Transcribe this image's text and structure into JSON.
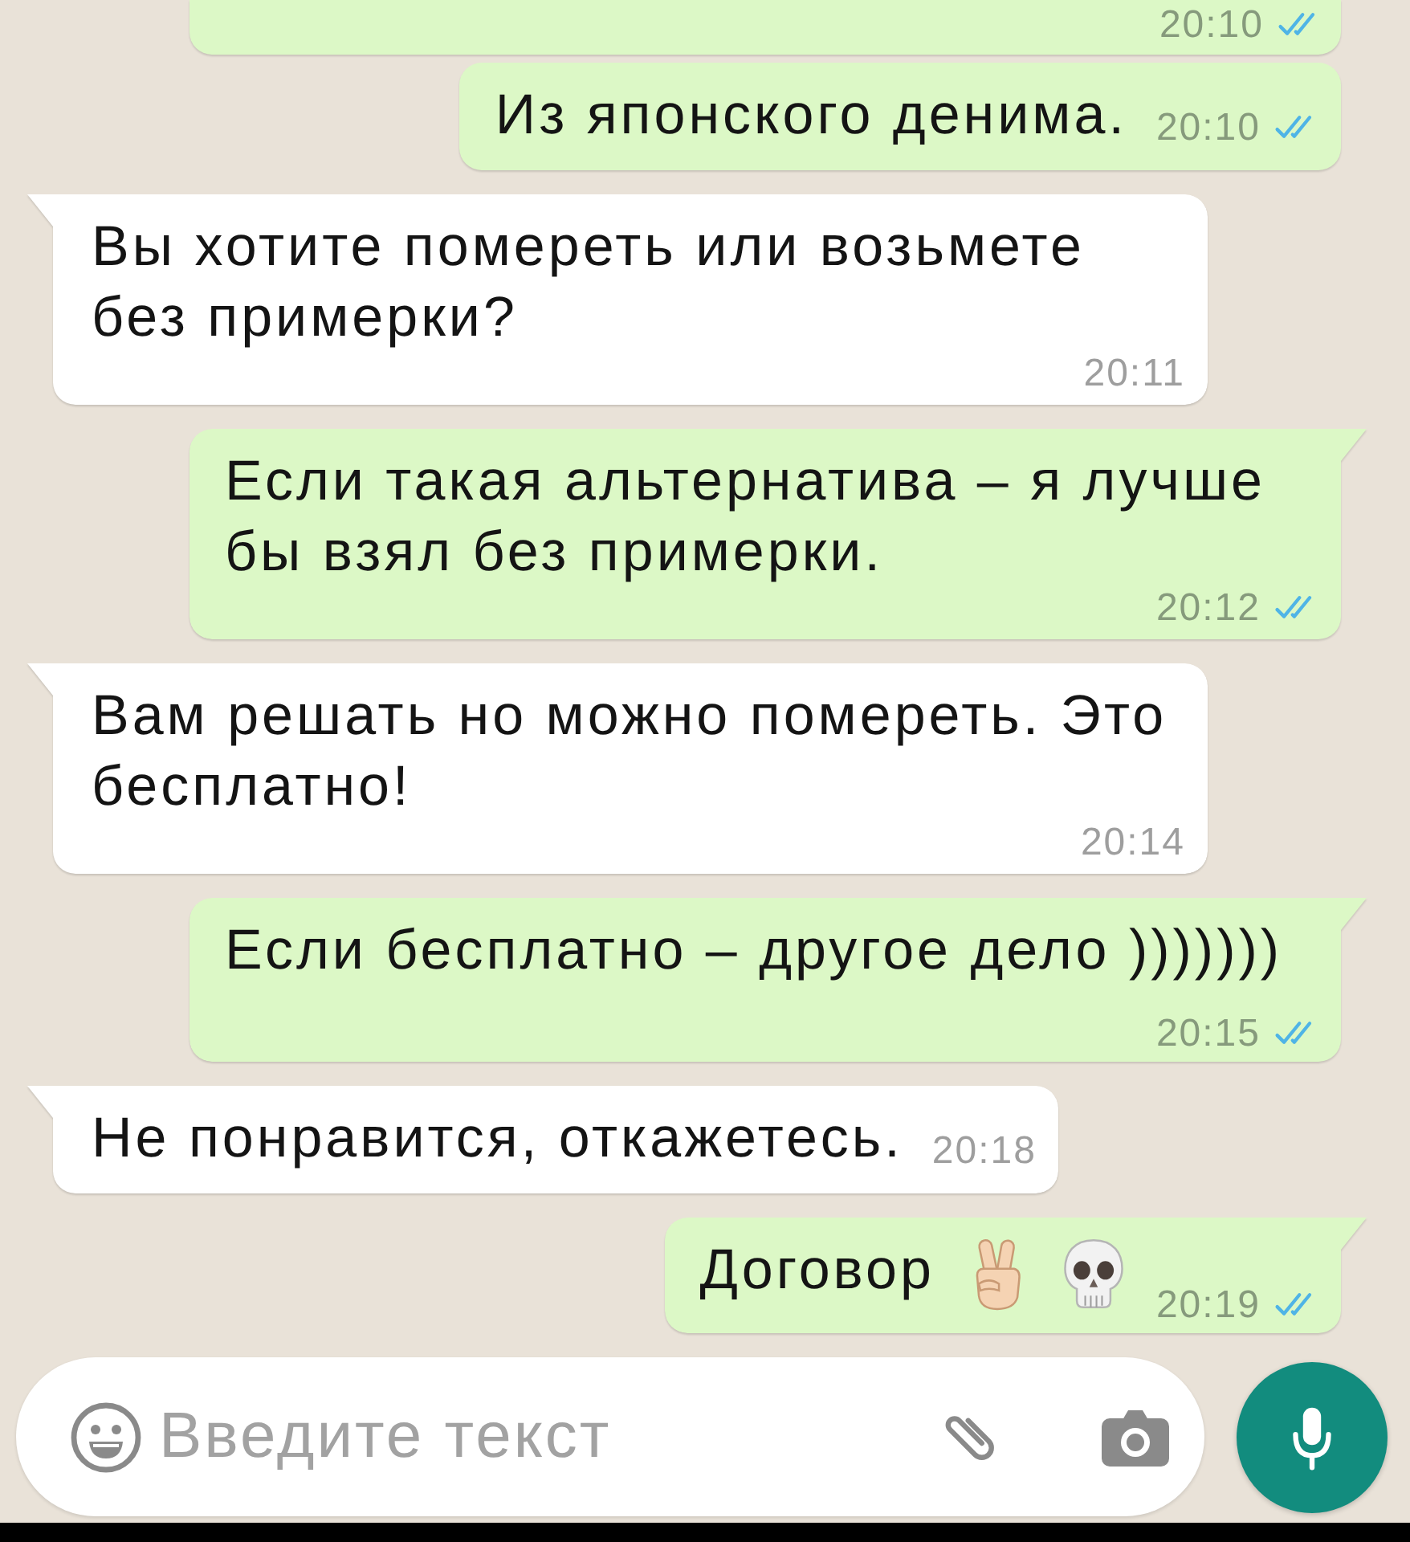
{
  "messages": [
    {
      "outgoing": true,
      "kind": "cut-off",
      "tail": false,
      "time": "20:10",
      "read": true
    },
    {
      "outgoing": true,
      "kind": "text",
      "tail": false,
      "text": "Из японского денима.",
      "time": "20:10",
      "read": true
    },
    {
      "outgoing": false,
      "kind": "text",
      "tail": true,
      "text": "Вы хотите помереть или возьмете без примерки?",
      "time": "20:11"
    },
    {
      "outgoing": true,
      "kind": "text",
      "tail": true,
      "text": "Если такая альтернатива – я лучше бы взял без примерки.",
      "time": "20:12",
      "read": true
    },
    {
      "outgoing": false,
      "kind": "text",
      "tail": true,
      "text": "Вам решать но можно помереть. Это бесплатно!",
      "time": "20:14"
    },
    {
      "outgoing": true,
      "kind": "text",
      "tail": true,
      "text": "Если бесплатно – другое дело )))))))",
      "time": "20:15",
      "read": true
    },
    {
      "outgoing": false,
      "kind": "text",
      "tail": true,
      "text": "Не понравится, откажетесь.",
      "time": "20:18"
    },
    {
      "outgoing": true,
      "kind": "text-with-emoji",
      "tail": true,
      "text": "Договор",
      "time": "20:19",
      "read": true
    }
  ],
  "composer": {
    "placeholder": "Введите текст"
  }
}
